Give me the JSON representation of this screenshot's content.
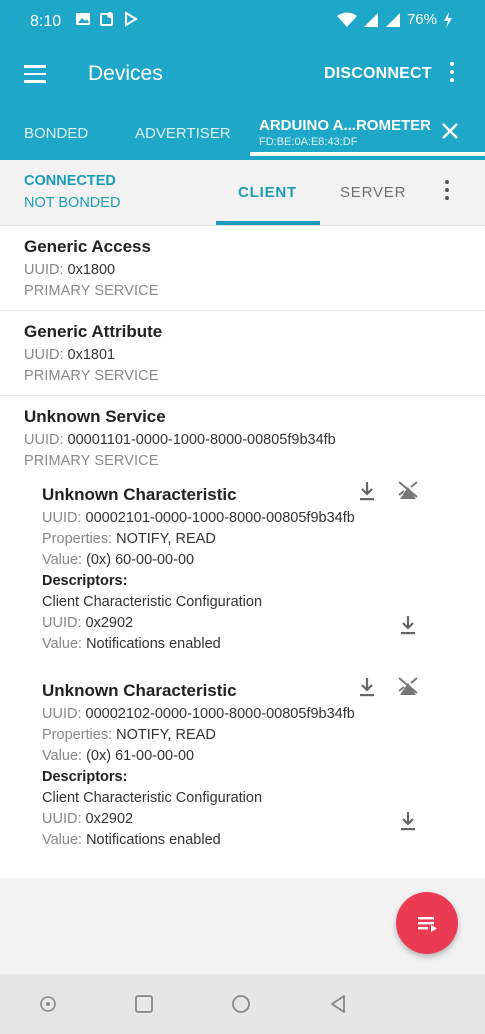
{
  "status": {
    "time": "8:10",
    "battery": "76%",
    "bar_color": "#1ea7c8"
  },
  "app_bar": {
    "title": "Devices",
    "disconnect_label": "DISCONNECT",
    "menu_icon": "hamburger-menu-icon",
    "overflow_icon": "more-vert-icon"
  },
  "tabs": {
    "bonded": "BONDED",
    "advertiser": "ADVERTISER",
    "device_name": "ARDUINO A...ROMETER",
    "device_mac": "FD:BE:0A:E8:43:DF",
    "close_icon": "close-icon"
  },
  "connection": {
    "status": "CONNECTED",
    "bond": "NOT BONDED",
    "client_tab": "CLIENT",
    "server_tab": "SERVER",
    "accent": "#1a9cb9"
  },
  "labels": {
    "uuid": "UUID:",
    "properties": "Properties:",
    "value": "Value:",
    "descriptors": "Descriptors:"
  },
  "services": [
    {
      "name": "Generic Access",
      "uuid": "0x1800",
      "type": "PRIMARY SERVICE"
    },
    {
      "name": "Generic Attribute",
      "uuid": "0x1801",
      "type": "PRIMARY SERVICE"
    },
    {
      "name": "Unknown Service",
      "uuid": "00001101-0000-1000-8000-00805f9b34fb",
      "type": "PRIMARY SERVICE"
    }
  ],
  "characteristics": [
    {
      "name": "Unknown Characteristic",
      "uuid": "00002101-0000-1000-8000-00805f9b34fb",
      "properties": "NOTIFY, READ",
      "value": "(0x) 60-00-00-00",
      "descriptor": {
        "name": "Client Characteristic Configuration",
        "uuid": "0x2902",
        "value": "Notifications enabled"
      }
    },
    {
      "name": "Unknown Characteristic",
      "uuid": "00002102-0000-1000-8000-00805f9b34fb",
      "properties": "NOTIFY, READ",
      "value": "(0x) 61-00-00-00",
      "descriptor": {
        "name": "Client Characteristic Configuration",
        "uuid": "0x2902",
        "value": "Notifications enabled"
      }
    }
  ],
  "fab": {
    "icon": "log-list-icon",
    "color": "#ea3b52"
  },
  "nav": {
    "icons": [
      "home-circle-icon",
      "recents-square-icon",
      "home-ring-icon",
      "back-triangle-icon"
    ]
  }
}
